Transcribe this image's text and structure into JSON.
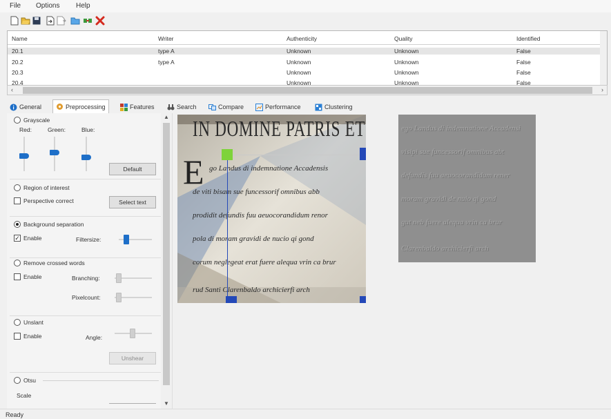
{
  "menu": {
    "file": "File",
    "options": "Options",
    "help": "Help"
  },
  "toolbar": {
    "icons": [
      "new-icon",
      "open-icon",
      "save-icon",
      "import-icon",
      "export-icon",
      "folder-icon",
      "compare-icon",
      "delete-icon"
    ]
  },
  "table": {
    "columns": [
      "Name",
      "Writer",
      "Authenticity",
      "Quality",
      "Identified"
    ],
    "rows": [
      {
        "name": "20.1",
        "writer": "type A",
        "authenticity": "Unknown",
        "quality": "Unknown",
        "identified": "False"
      },
      {
        "name": "20.2",
        "writer": "type A",
        "authenticity": "Unknown",
        "quality": "Unknown",
        "identified": "False"
      },
      {
        "name": "20.3",
        "writer": "",
        "authenticity": "Unknown",
        "quality": "Unknown",
        "identified": "False"
      },
      {
        "name": "20.4",
        "writer": "",
        "authenticity": "Unknown",
        "quality": "Unknown",
        "identified": "False"
      }
    ]
  },
  "tabs": [
    {
      "label": "General",
      "icon": "info-icon",
      "color": "#1e6fc8"
    },
    {
      "label": "Preprocessing",
      "icon": "gear-icon",
      "color": "#d98a1e"
    },
    {
      "label": "Features",
      "icon": "features-icon",
      "color": "#c0392b"
    },
    {
      "label": "Search",
      "icon": "binoculars-icon",
      "color": "#555555"
    },
    {
      "label": "Compare",
      "icon": "compare-icon",
      "color": "#2a7fd4"
    },
    {
      "label": "Performance",
      "icon": "performance-icon",
      "color": "#2a7fd4"
    },
    {
      "label": "Clustering",
      "icon": "clustering-icon",
      "color": "#2a7fd4"
    }
  ],
  "preprocessing": {
    "grayscale": {
      "label": "Grayscale",
      "red": "Red:",
      "green": "Green:",
      "blue": "Blue:",
      "default_button": "Default",
      "red_level": 0.45,
      "green_level": 0.55,
      "blue_level": 0.4
    },
    "roi": {
      "label": "Region of interest",
      "perspective": "Perspective correct",
      "select_button": "Select text"
    },
    "background": {
      "label": "Background separation",
      "enable": "Enable",
      "filtersize": "Filtersize:",
      "filtersize_level": 0.15
    },
    "crossed": {
      "label": "Remove crossed words",
      "enable": "Enable",
      "branching": "Branching:",
      "pixelcount": "Pixelcount:"
    },
    "unslant": {
      "label": "Unslant",
      "enable": "Enable",
      "angle": "Angle:",
      "button": "Unshear"
    },
    "otsu": {
      "label": "Otsu"
    },
    "scale": {
      "label": "Scale"
    }
  },
  "manuscript": {
    "line1": "IN DOMINE PATRIS ET FI",
    "line2": "go Landus di indemnatione Accadensis",
    "line3": "de viti bisam sue funcessorif omnibus abb",
    "line4": "prodidit defundis fuu aeuocorandidum renor",
    "line5": "pola di moram gravidi de nucio qi gond",
    "line6": "corum neglegeat erat fuere alequa vrin ca brur",
    "line7": "rud Santi Clarenbaldo archicierfi arch"
  },
  "processed": {
    "line1": "ego Landus di indemnatione Accadensi",
    "line2": "visipi sue funcessorif omnibus abt",
    "line3": "defundis fuu aeuocorandidum rener",
    "line4": "moram gravidi de nuio qi gond",
    "line5": "gut neb fuere alequa vrin ca brur",
    "line6": "Clarenbaldo archicierfi arch"
  },
  "status": {
    "text": "Ready"
  },
  "colors": {
    "accent": "#1e6fc8",
    "roi_green": "#7ed33a",
    "roi_blue": "#2449b8",
    "delete": "#d42a1e"
  }
}
